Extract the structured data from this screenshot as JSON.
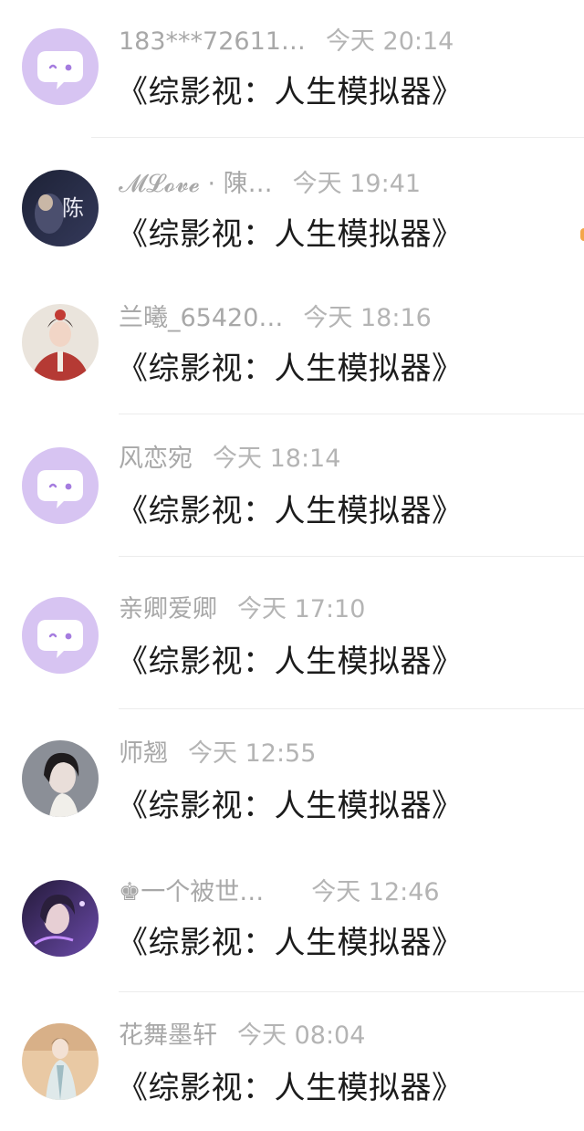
{
  "colors": {
    "default_avatar_bg": "#d7c4f2",
    "default_avatar_bubble": "#ffffff",
    "default_avatar_face": "#a57cdf",
    "name_text": "#a8a8a8",
    "message_text": "#1c1c1c",
    "divider": "#ececec"
  },
  "messages": [
    {
      "name": "183***72611…",
      "time": "今天 20:14",
      "text": "《综影视：人生模拟器》",
      "avatar": "default-chat-bubble-icon"
    },
    {
      "name": "𝓜𝓛𝓸𝓿𝓮 · 陳…",
      "time": "今天 19:41",
      "text": "《综影视：人生模拟器》",
      "avatar": "user-photo-avatar"
    },
    {
      "name": "兰曦_65420…",
      "time": "今天 18:16",
      "text": "《综影视：人生模拟器》",
      "avatar": "user-photo-avatar"
    },
    {
      "name": "风恋宛",
      "time": "今天 18:14",
      "text": "《综影视：人生模拟器》",
      "avatar": "default-chat-bubble-icon"
    },
    {
      "name": "亲卿爱卿",
      "time": "今天 17:10",
      "text": "《综影视：人生模拟器》",
      "avatar": "default-chat-bubble-icon"
    },
    {
      "name": "师翘",
      "time": "今天 12:55",
      "text": "《综影视：人生模拟器》",
      "avatar": "user-photo-avatar"
    },
    {
      "name": "♚一个被世…",
      "time": "今天 12:46",
      "text": "《综影视：人生模拟器》",
      "avatar": "user-photo-avatar"
    },
    {
      "name": "花舞墨轩",
      "time": "今天 08:04",
      "text": "《综影视：人生模拟器》",
      "avatar": "user-photo-avatar"
    }
  ]
}
